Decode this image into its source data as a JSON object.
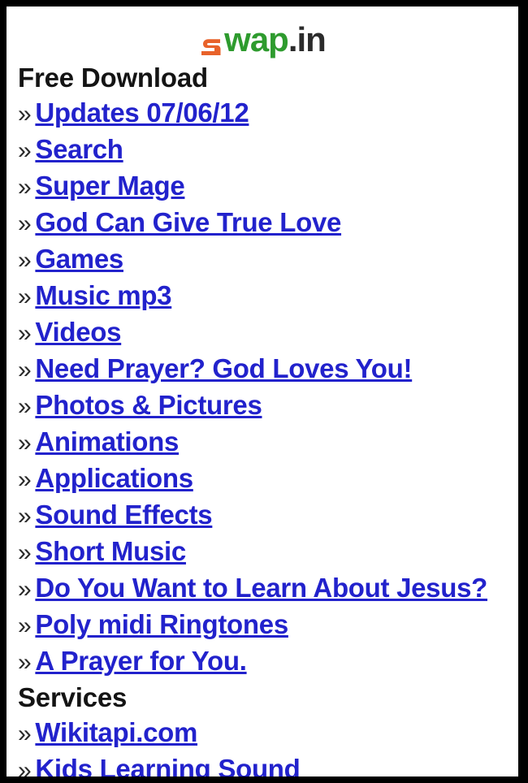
{
  "page": {
    "background_color": "#ffffff",
    "frame_color": "#000000",
    "link_color": "#2222CC",
    "heading_color": "#141414",
    "bullet_color": "#2A2A2A"
  },
  "header": {
    "logo_mark_color": "#E8622A",
    "logo_mark_name": "orange-swirl-mark",
    "logo_word": "wap",
    "logo_word_color": "#2E9B2E",
    "logo_tld": ".in",
    "logo_tld_color": "#2B2B2B",
    "full_brand": "wap.in"
  },
  "sections": [
    {
      "heading": "Free Download",
      "items": [
        {
          "bullet": "»",
          "label": "Updates 07/06/12"
        },
        {
          "bullet": "»",
          "label": "Search"
        },
        {
          "bullet": "»",
          "label": "Super Mage"
        },
        {
          "bullet": "»",
          "label": "God Can Give True Love"
        },
        {
          "bullet": "»",
          "label": "Games"
        },
        {
          "bullet": "»",
          "label": "Music mp3"
        },
        {
          "bullet": "»",
          "label": "Videos"
        },
        {
          "bullet": "»",
          "label": "Need Prayer? God Loves You!"
        },
        {
          "bullet": "»",
          "label": "Photos & Pictures"
        },
        {
          "bullet": "»",
          "label": "Animations"
        },
        {
          "bullet": "»",
          "label": "Applications"
        },
        {
          "bullet": "»",
          "label": "Sound Effects"
        },
        {
          "bullet": "»",
          "label": "Short Music"
        },
        {
          "bullet": "»",
          "label": "Do You Want to Learn About Jesus?"
        },
        {
          "bullet": "»",
          "label": "Poly midi Ringtones"
        },
        {
          "bullet": "»",
          "label": "A Prayer for You."
        }
      ]
    },
    {
      "heading": "Services",
      "items": [
        {
          "bullet": "»",
          "label": "Wikitapi.com"
        },
        {
          "bullet": "»",
          "label": "Kids Learning Sound"
        }
      ]
    }
  ]
}
